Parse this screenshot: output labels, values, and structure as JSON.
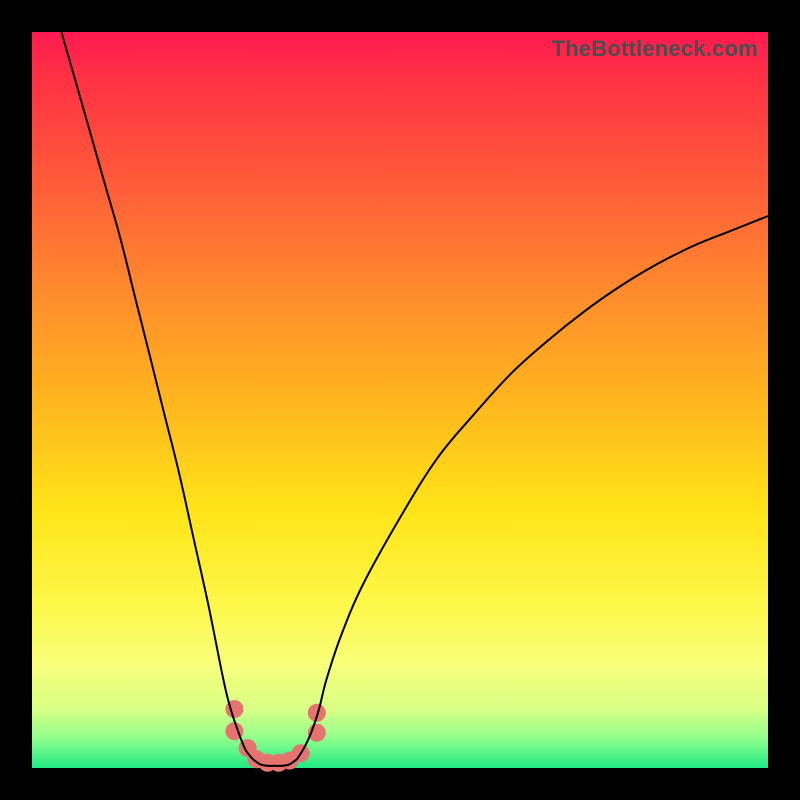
{
  "watermark": "TheBottleneck.com",
  "chart_data": {
    "type": "line",
    "title": "",
    "xlabel": "",
    "ylabel": "",
    "xlim": [
      0,
      100
    ],
    "ylim": [
      0,
      100
    ],
    "grid": false,
    "legend": false,
    "series": [
      {
        "name": "curve-left",
        "x": [
          4,
          6,
          8,
          10,
          12,
          14,
          16,
          18,
          20,
          22,
          24,
          26,
          27,
          28,
          29,
          30
        ],
        "values": [
          100,
          93,
          86,
          79,
          72,
          64,
          56,
          48,
          40,
          31,
          22,
          12,
          8,
          5,
          2.5,
          1.2
        ]
      },
      {
        "name": "curve-right",
        "x": [
          36,
          37,
          38,
          39,
          40,
          42,
          45,
          50,
          55,
          60,
          65,
          70,
          75,
          80,
          85,
          90,
          95,
          100
        ],
        "values": [
          1.2,
          2.8,
          5,
          8,
          12,
          18,
          25,
          34,
          42,
          48,
          53.5,
          58,
          62,
          65.5,
          68.5,
          71,
          73,
          75
        ]
      },
      {
        "name": "floor",
        "x": [
          30,
          31,
          32,
          33,
          34,
          35,
          36
        ],
        "values": [
          1.2,
          0.5,
          0.3,
          0.3,
          0.3,
          0.5,
          1.2
        ]
      }
    ],
    "markers": [
      {
        "x": 27.5,
        "y": 8.0
      },
      {
        "x": 27.5,
        "y": 5.0
      },
      {
        "x": 29.3,
        "y": 2.7
      },
      {
        "x": 30.5,
        "y": 1.2
      },
      {
        "x": 32.0,
        "y": 0.7
      },
      {
        "x": 33.5,
        "y": 0.7
      },
      {
        "x": 35.0,
        "y": 1.0
      },
      {
        "x": 36.5,
        "y": 2.0
      },
      {
        "x": 38.7,
        "y": 7.5
      },
      {
        "x": 38.7,
        "y": 4.8
      }
    ],
    "style": {
      "curve_stroke": "#000000",
      "curve_width": 2,
      "marker_fill": "#e5736f",
      "marker_radius": 9,
      "background_gradient": [
        "#ff1a52",
        "#20e985"
      ]
    }
  }
}
